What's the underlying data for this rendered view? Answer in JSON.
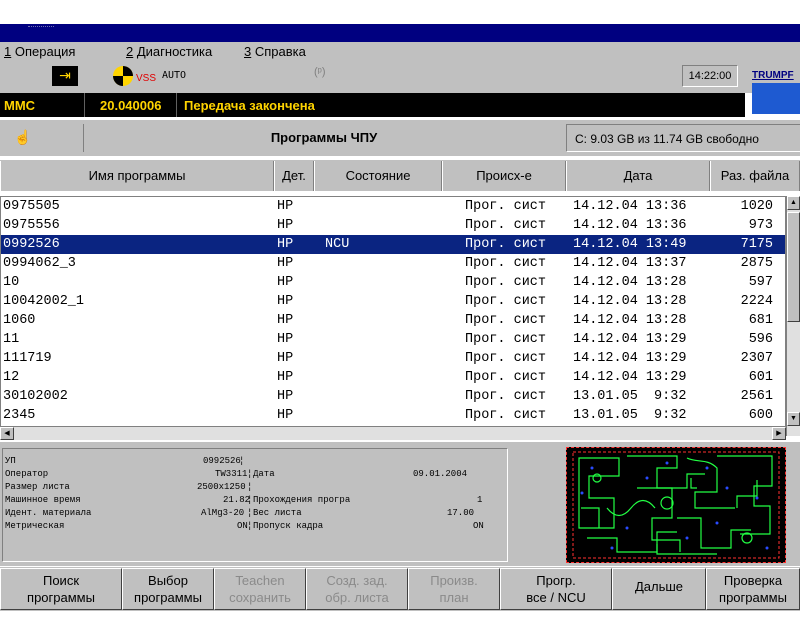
{
  "menu": [
    {
      "num": "1",
      "label": " Операция"
    },
    {
      "num": "2",
      "label": " Диагностика"
    },
    {
      "num": "3",
      "label": " Справка"
    }
  ],
  "toolbar": {
    "vss": "VSS",
    "auto": "AUTO",
    "clock": "14:22:00",
    "trumpf": "TRUMPF"
  },
  "status": {
    "mode": "MMC",
    "program_number": "20.040006",
    "message": "Передача закончена"
  },
  "section": {
    "title": "Программы ЧПУ",
    "disk_info": "C: 9.03 GB из 11.74 GB свободно"
  },
  "columns": [
    "Имя программы",
    "Дет.",
    "Состояние",
    "Происх-е",
    "Дата",
    "Раз. файла"
  ],
  "rows": [
    {
      "name": "0975505",
      "det": "HP",
      "state": "",
      "origin": "Прог. сист",
      "date": "14.12.04 13:36",
      "size": "1020"
    },
    {
      "name": "0975556",
      "det": "HP",
      "state": "",
      "origin": "Прог. сист",
      "date": "14.12.04 13:36",
      "size": "973"
    },
    {
      "name": "0992526",
      "det": "HP",
      "state": "NCU",
      "origin": "Прог. сист",
      "date": "14.12.04 13:49",
      "size": "7175"
    },
    {
      "name": "0994062_3",
      "det": "HP",
      "state": "",
      "origin": "Прог. сист",
      "date": "14.12.04 13:37",
      "size": "2875"
    },
    {
      "name": "10",
      "det": "HP",
      "state": "",
      "origin": "Прог. сист",
      "date": "14.12.04 13:28",
      "size": "597"
    },
    {
      "name": "10042002_1",
      "det": "HP",
      "state": "",
      "origin": "Прог. сист",
      "date": "14.12.04 13:28",
      "size": "2224"
    },
    {
      "name": "1060",
      "det": "HP",
      "state": "",
      "origin": "Прог. сист",
      "date": "14.12.04 13:28",
      "size": "681"
    },
    {
      "name": "11",
      "det": "HP",
      "state": "",
      "origin": "Прог. сист",
      "date": "14.12.04 13:29",
      "size": "596"
    },
    {
      "name": "111719",
      "det": "HP",
      "state": "",
      "origin": "Прог. сист",
      "date": "14.12.04 13:29",
      "size": "2307"
    },
    {
      "name": "12",
      "det": "HP",
      "state": "",
      "origin": "Прог. сист",
      "date": "14.12.04 13:29",
      "size": "601"
    },
    {
      "name": "30102002",
      "det": "HP",
      "state": "",
      "origin": "Прог. сист",
      "date": "13.01.05  9:32",
      "size": "2561"
    },
    {
      "name": "2345",
      "det": "HP",
      "state": "",
      "origin": "Прог. сист",
      "date": "13.01.05  9:32",
      "size": "600"
    }
  ],
  "selected_row": 2,
  "info": {
    "up_label": "УП",
    "up_value": "0992526",
    "operator_label": "Оператор",
    "operator_value": "TW3311",
    "date_label": "Дата",
    "date_value": "09.01.2004",
    "sheet_size_label": "Размер листа",
    "sheet_size_value": "2500x1250",
    "machine_time_label": "Машинное время",
    "machine_time_value": "21.82",
    "passes_label": "Прохождения програ",
    "passes_value": "1",
    "material_label": "Идент. материала",
    "material_value": "AlMg3-20",
    "sheet_weight_label": "Вес листа",
    "sheet_weight_value": "17.00",
    "metric_label": "Метрическая",
    "metric_value": "ON",
    "skip_label": "Пропуск кадра",
    "skip_value": "ON"
  },
  "softkeys": [
    {
      "line1": "Поиск",
      "line2": "программы",
      "enabled": true
    },
    {
      "line1": "Выбор",
      "line2": "программы",
      "enabled": true
    },
    {
      "line1": "Teachen",
      "line2": "сохранить",
      "enabled": false
    },
    {
      "line1": "Созд. зад.",
      "line2": "обр. листа",
      "enabled": false
    },
    {
      "line1": "Произв.",
      "line2": "план",
      "enabled": false
    },
    {
      "line1": "Прогр.",
      "line2": "все / NCU",
      "enabled": true
    },
    {
      "line1": "Дальше",
      "line2": "",
      "enabled": true
    },
    {
      "line1": "Проверка",
      "line2": "программы",
      "enabled": true
    }
  ],
  "colors": {
    "title_bar": "#000080",
    "selection": "#0a2481",
    "status_text": "#ffd400",
    "panel": "#c0c0c0"
  },
  "icons": [
    "exit-icon",
    "vss-icon",
    "antenna-icon",
    "hand-icon",
    "scroll-up-icon",
    "scroll-down-icon",
    "scroll-left-icon",
    "scroll-right-icon"
  ]
}
